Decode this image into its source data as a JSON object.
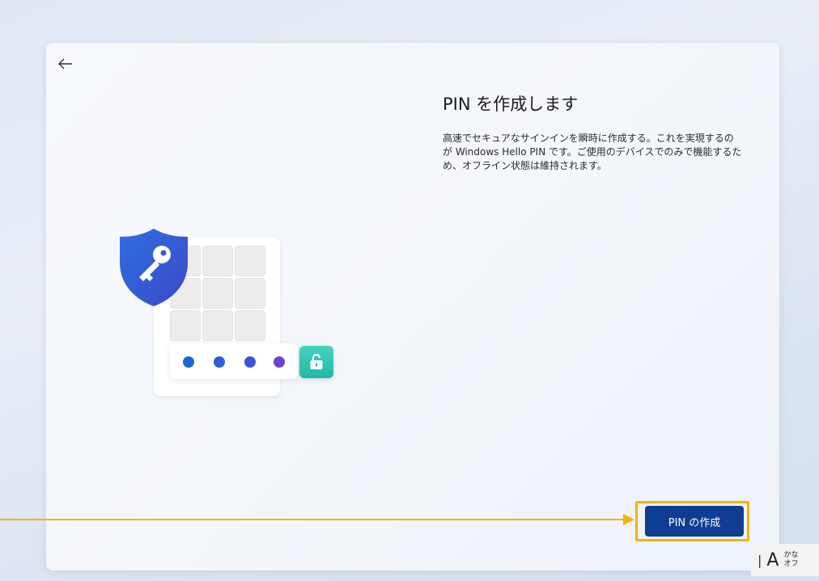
{
  "setup": {
    "title": "PIN を作成します",
    "description": "高速でセキュアなサインインを瞬時に作成する。これを実現するのが Windows Hello PIN です。ご使用のデバイスでのみで機能するため、オフライン状態は維持されます。",
    "create_button_label": "PIN の作成",
    "back_icon": "arrow-left-icon"
  },
  "illustration": {
    "shield_icon": "key-shield-icon",
    "lock_icon": "unlock-icon",
    "pin_dot_colors": [
      "#1f64d6",
      "#2a5fd8",
      "#3a55d6",
      "#6a45d2"
    ],
    "lock_color": "#2cc2ae",
    "shield_color": "#2f5fd6"
  },
  "ime": {
    "mode_label": "A",
    "kana_line1": "かな",
    "kana_line2": "オフ"
  },
  "colors": {
    "accent": "#0f3d91",
    "highlight": "#f2b400"
  }
}
